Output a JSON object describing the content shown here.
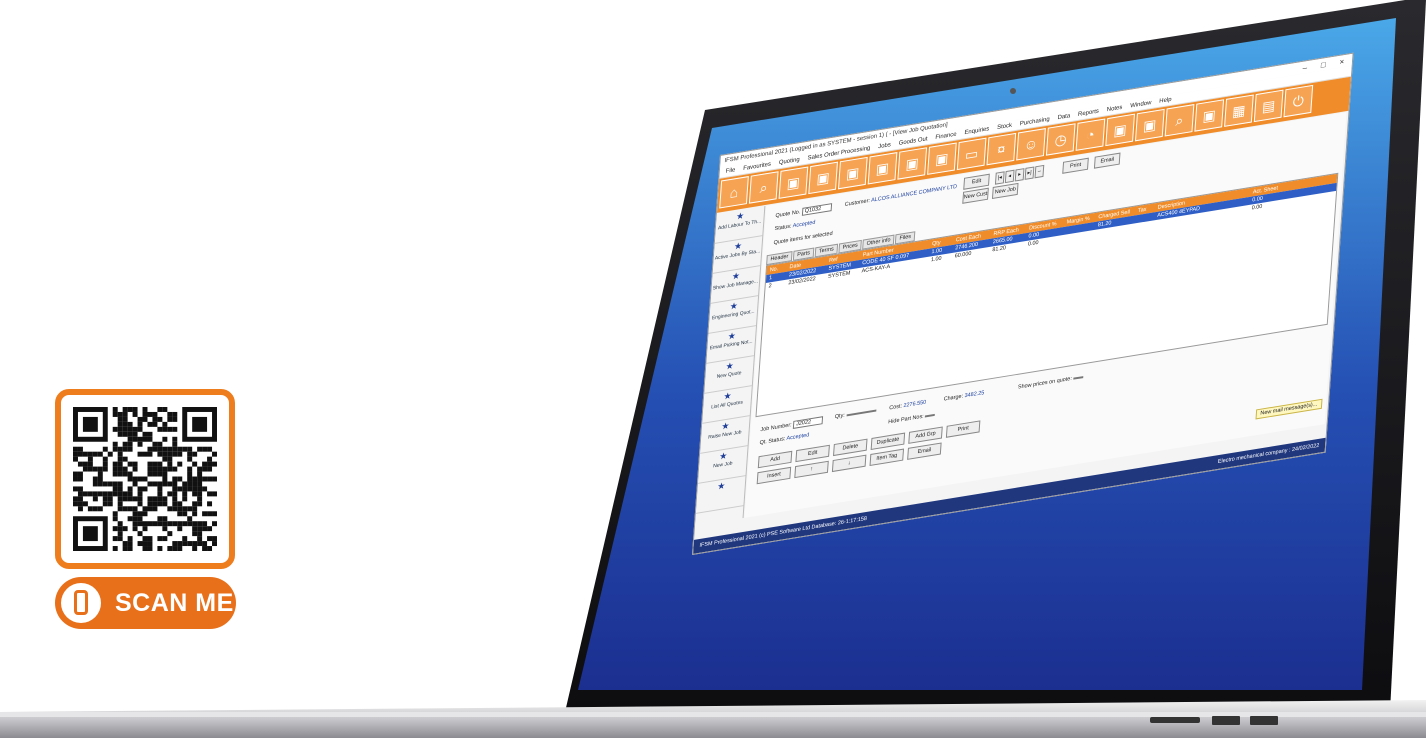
{
  "promo": {
    "scan_label": "SCAN ME",
    "brand_color": "#e8701a"
  },
  "app": {
    "title": "IFSM Professional 2021 (Logged in as SYSTEM - session 1) ( - [View Job Quotation]",
    "window_controls": [
      "–",
      "□",
      "×"
    ],
    "menu": [
      "File",
      "Favourites",
      "Quoting",
      "Sales Order Processing",
      "Jobs",
      "Goods Out",
      "Finance",
      "Enquiries",
      "Stock",
      "Purchasing",
      "Data",
      "Reports",
      "Notes",
      "Window",
      "Help"
    ],
    "toolbar_icons": [
      "home-icon",
      "search-icon",
      "quote-icon",
      "document-icon",
      "calendar-icon",
      "wrench-icon",
      "invoice-icon",
      "box-icon",
      "truck-icon",
      "money-icon",
      "person-icon",
      "gauge-icon",
      "chart-icon",
      "report-icon",
      "enquiry-icon",
      "magnify-icon",
      "notes-icon",
      "grid-icon",
      "calculator-icon",
      "power-icon"
    ],
    "sidebar": [
      "Add Labour To Th...",
      "Active Jobs By Sta...",
      "Show Job Manage...",
      "Engineering Quot...",
      "Email Picking Not...",
      "New Quote",
      "List All Quotes",
      "Raise New Job",
      "New Job",
      ""
    ],
    "quote": {
      "quote_no_label": "Quote No.",
      "quote_no": "Q1032",
      "customer_label": "Customer:",
      "customer": "ALCOS ALLIANCE COMPANY LTD",
      "status_label": "Status:",
      "status": "Accepted",
      "items_note": "Quote items for selected",
      "edit": "Edit",
      "new_cust": "New Cust",
      "new_job": "New Job",
      "nav": [
        "|◂",
        "◂",
        "▸",
        "▸|",
        "–"
      ],
      "print": "Print",
      "email": "Email"
    },
    "tabs": [
      "Header",
      "Parts",
      "Terms",
      "Prices",
      "Other info",
      "Files"
    ],
    "grid_headers": [
      "No.",
      "Date",
      "Ref",
      "Part Number",
      "Qty",
      "Cost Each",
      "RRP Each",
      "Discount %",
      "Margin %",
      "Charged Sell",
      "Tax",
      "Description",
      "Act. Sheet"
    ],
    "grid_rows": [
      [
        "1",
        "23/02/2022",
        "SYSTEM",
        "CODE 40 SF 0.097",
        "1.00",
        "2746.200",
        "2665.00",
        "0.00",
        "",
        "81.20",
        "",
        "ACS400 4EYPAD",
        "0.00"
      ],
      [
        "2",
        "23/02/2022",
        "SYSTEM",
        "ACS-KAY-A",
        "1.00",
        "60.000",
        "81.20",
        "0.00",
        "",
        "",
        "",
        "",
        "0.00"
      ]
    ],
    "lower": {
      "job_number_label": "Job Number:",
      "job_number": "J2022",
      "qty_label": "Qty:",
      "qty": "",
      "cost_label": "Cost:",
      "cost": "2276.550",
      "charge_label": "Charge:",
      "charge": "3482.25",
      "show_prices_label": "Show prices on quote:",
      "qt_status_label": "Qt. Status:",
      "qt_status": "Accepted",
      "hide_part_nos_label": "Hide Part Nos:",
      "buttons_row1": [
        "Add",
        "Edit",
        "Delete",
        "Duplicate",
        "Add Grp",
        "Print"
      ],
      "buttons_row2": [
        "Insert",
        "↑",
        "↓",
        "Item Tag",
        "Email"
      ]
    },
    "new_mail": "New mail message(s)...",
    "status_left": "IFSM Professional 2021 (c) PSE Software Ltd Database: 26-1:17:158",
    "status_right": "Electro mechanical company : 24/02/2022",
    "accent_color": "#f08d2a",
    "status_color": "#20377e"
  }
}
